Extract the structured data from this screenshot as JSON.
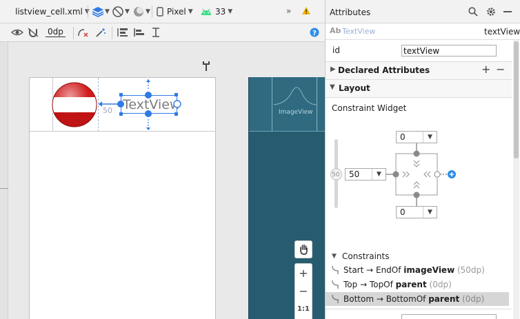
{
  "toolbar": {
    "file_name": "listview_cell.xml",
    "device": "Pixel",
    "api_level": "33",
    "more": "»",
    "dp_value": "0dp"
  },
  "canvas": {
    "textview_label": "TextView",
    "margin_label": "50",
    "blueprint_label": "ImageView"
  },
  "zoom": {
    "plus": "+",
    "minus": "−",
    "ratio": "1:1"
  },
  "attributes": {
    "title": "Attributes",
    "widget_type": "TextView",
    "widget_prefix": "Ab",
    "widget_id_display": "textView",
    "id_label": "id",
    "id_value": "textView",
    "declared_attributes": "Declared Attributes",
    "layout": "Layout",
    "constraint_widget": "Constraint Widget",
    "top_margin": "0",
    "left_margin": "50",
    "bottom_margin": "0",
    "bias": "50",
    "constraints_header": "Constraints",
    "constraints": [
      {
        "prefix": "Start → EndOf ",
        "target": "imageView",
        "value": " (50dp)"
      },
      {
        "prefix": "Top → TopOf ",
        "target": "parent",
        "value": " (0dp)"
      },
      {
        "prefix": "Bottom → BottomOf ",
        "target": "parent",
        "value": " (0dp)"
      }
    ]
  },
  "colors": {
    "accent": "#2f7be5",
    "blueprint": "#275c70",
    "warning": "#f2b400",
    "android": "#3ddc84"
  }
}
